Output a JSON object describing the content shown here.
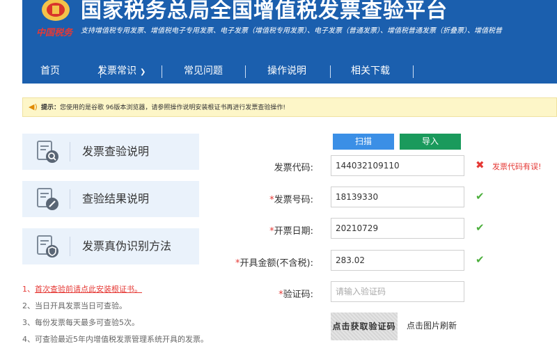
{
  "header": {
    "slogan": "中国税务",
    "title": "国家税务总局全国增值税发票查验平台",
    "subtitle": "支持增值税专用发票、增值税电子专用发票、电子发票（增值税专用发票）、电子发票（普通发票）、增值税普通发票（折叠票）、增值税普"
  },
  "nav": {
    "items": [
      {
        "label": "首页"
      },
      {
        "label": "发票常识"
      },
      {
        "label": "常见问题"
      },
      {
        "label": "操作说明"
      },
      {
        "label": "相关下载"
      }
    ]
  },
  "notice": {
    "prefix": "提示：",
    "text": "您使用的是谷歌 96版本浏览器，请参照操作说明安装根证书再进行发票查验操作!"
  },
  "sidebar": {
    "cards": [
      {
        "label": "发票查验说明"
      },
      {
        "label": "查验结果说明"
      },
      {
        "label": "发票真伪识别方法"
      }
    ]
  },
  "notes": [
    {
      "num": "1、",
      "text": "首次查验前请点此安装根证书。"
    },
    {
      "num": "2、",
      "text": "当日开具发票当日可查验。"
    },
    {
      "num": "3、",
      "text": "每份发票每天最多可查验5次。"
    },
    {
      "num": "4、",
      "text": "可查验最近5年内增值税发票管理系统开具的发票。"
    }
  ],
  "buttons": {
    "scan": "扫描",
    "import": "导入"
  },
  "form": {
    "code": {
      "label": "发票代码:",
      "value": "144032109110",
      "error": "发票代码有误!"
    },
    "number": {
      "req": "*",
      "label": "发票号码:",
      "value": "18139330"
    },
    "date": {
      "req": "*",
      "label": "开票日期:",
      "value": "20210729"
    },
    "amount": {
      "req": "*",
      "label": "开具金额(不含税):",
      "value": "283.02"
    },
    "captcha": {
      "req": "*",
      "label": "验证码:",
      "placeholder": "请输入验证码"
    }
  },
  "captcha": {
    "image_text": "点击获取验证码",
    "refresh_hint": "点击图片刷新"
  },
  "icons": {
    "speaker": "speaker-icon",
    "doc_search": "document-search-icon",
    "doc_edit": "document-edit-icon",
    "doc_shield": "document-shield-icon",
    "check": "check-icon",
    "cross": "cross-icon",
    "chevron": "chevron-down-icon"
  },
  "colors": {
    "header_bg": "#1b5fae",
    "scan_button": "#3b8fe6",
    "import_button": "#1a9a5c",
    "error": "#e53935",
    "valid": "#4caf3c",
    "notice_bg": "#fdf6c8",
    "card_bg": "#eaf2fb"
  }
}
